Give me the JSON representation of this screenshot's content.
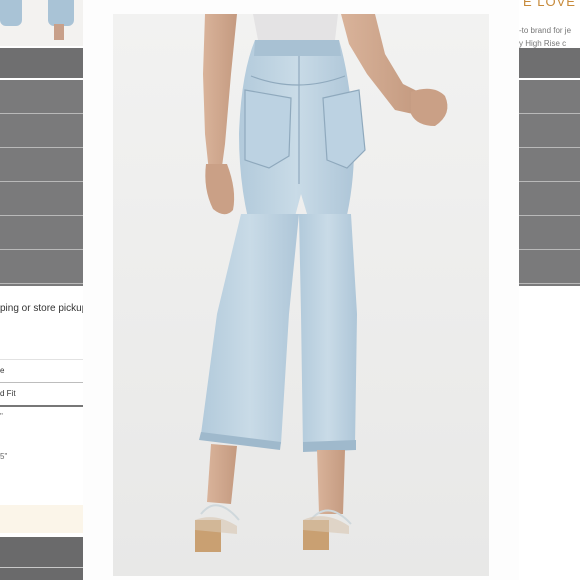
{
  "left_panel": {
    "thumbnail_alt": "jeans thumbnail",
    "shipping_text": "ping or store pickup",
    "options": [
      {
        "label": "e"
      },
      {
        "label": "d Fit"
      }
    ],
    "measurements": [
      "\"",
      "5\""
    ]
  },
  "product_image": {
    "label": "light wash cropped jeans, back view"
  },
  "right_panel": {
    "heading": "E LOVE IT",
    "description_lines": [
      "-to brand for je",
      "y High Rise c"
    ]
  },
  "colors": {
    "panel_gray": "#7a7a7b",
    "denim": "#b9d0df",
    "accent": "#c78a3a"
  }
}
